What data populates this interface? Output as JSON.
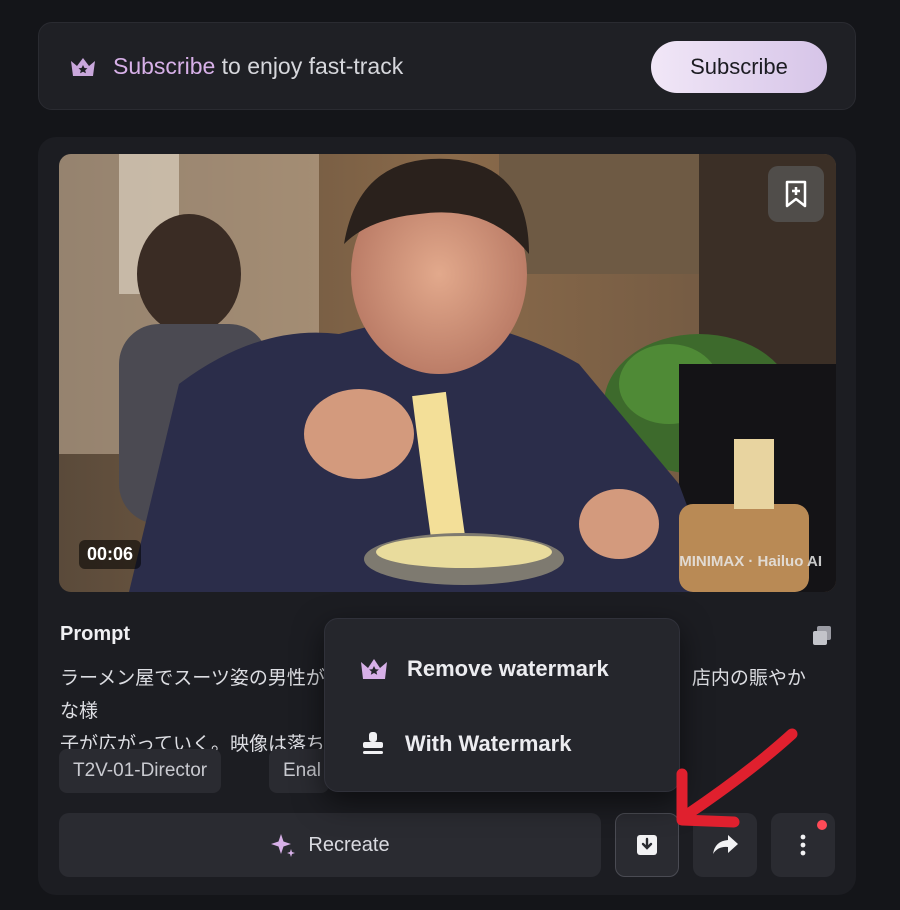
{
  "banner": {
    "highlight": "Subscribe",
    "text": " to enjoy fast-track",
    "button_label": "Subscribe",
    "icon": "crown-icon"
  },
  "video": {
    "duration": "00:06",
    "watermark": "MINIMAX · Hailuo AI"
  },
  "prompt": {
    "title": "Prompt",
    "line1_left": "ラーメン屋でスーツ姿の男性が美",
    "line1_right": "店内の賑やかな様",
    "line2_left": "子が広がっていく。映像は落ち"
  },
  "tags": [
    "T2V-01-Director",
    "Enal"
  ],
  "actions": {
    "recreate_label": "Recreate"
  },
  "menu": {
    "items": [
      {
        "label": "Remove watermark",
        "icon": "crown-icon"
      },
      {
        "label": "With Watermark",
        "icon": "stamp-icon"
      }
    ]
  },
  "colors": {
    "accent": "#d7b0e8",
    "arrow": "#e0202e",
    "badge": "#ff4a57"
  }
}
